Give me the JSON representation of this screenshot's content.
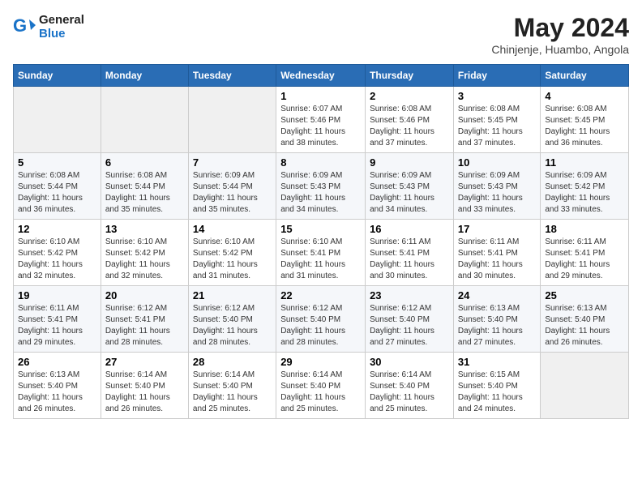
{
  "header": {
    "logo_line1": "General",
    "logo_line2": "Blue",
    "month": "May 2024",
    "location": "Chinjenje, Huambo, Angola"
  },
  "columns": [
    "Sunday",
    "Monday",
    "Tuesday",
    "Wednesday",
    "Thursday",
    "Friday",
    "Saturday"
  ],
  "weeks": [
    [
      {
        "day": "",
        "info": ""
      },
      {
        "day": "",
        "info": ""
      },
      {
        "day": "",
        "info": ""
      },
      {
        "day": "1",
        "info": "Sunrise: 6:07 AM\nSunset: 5:46 PM\nDaylight: 11 hours and 38 minutes."
      },
      {
        "day": "2",
        "info": "Sunrise: 6:08 AM\nSunset: 5:46 PM\nDaylight: 11 hours and 37 minutes."
      },
      {
        "day": "3",
        "info": "Sunrise: 6:08 AM\nSunset: 5:45 PM\nDaylight: 11 hours and 37 minutes."
      },
      {
        "day": "4",
        "info": "Sunrise: 6:08 AM\nSunset: 5:45 PM\nDaylight: 11 hours and 36 minutes."
      }
    ],
    [
      {
        "day": "5",
        "info": "Sunrise: 6:08 AM\nSunset: 5:44 PM\nDaylight: 11 hours and 36 minutes."
      },
      {
        "day": "6",
        "info": "Sunrise: 6:08 AM\nSunset: 5:44 PM\nDaylight: 11 hours and 35 minutes."
      },
      {
        "day": "7",
        "info": "Sunrise: 6:09 AM\nSunset: 5:44 PM\nDaylight: 11 hours and 35 minutes."
      },
      {
        "day": "8",
        "info": "Sunrise: 6:09 AM\nSunset: 5:43 PM\nDaylight: 11 hours and 34 minutes."
      },
      {
        "day": "9",
        "info": "Sunrise: 6:09 AM\nSunset: 5:43 PM\nDaylight: 11 hours and 34 minutes."
      },
      {
        "day": "10",
        "info": "Sunrise: 6:09 AM\nSunset: 5:43 PM\nDaylight: 11 hours and 33 minutes."
      },
      {
        "day": "11",
        "info": "Sunrise: 6:09 AM\nSunset: 5:42 PM\nDaylight: 11 hours and 33 minutes."
      }
    ],
    [
      {
        "day": "12",
        "info": "Sunrise: 6:10 AM\nSunset: 5:42 PM\nDaylight: 11 hours and 32 minutes."
      },
      {
        "day": "13",
        "info": "Sunrise: 6:10 AM\nSunset: 5:42 PM\nDaylight: 11 hours and 32 minutes."
      },
      {
        "day": "14",
        "info": "Sunrise: 6:10 AM\nSunset: 5:42 PM\nDaylight: 11 hours and 31 minutes."
      },
      {
        "day": "15",
        "info": "Sunrise: 6:10 AM\nSunset: 5:41 PM\nDaylight: 11 hours and 31 minutes."
      },
      {
        "day": "16",
        "info": "Sunrise: 6:11 AM\nSunset: 5:41 PM\nDaylight: 11 hours and 30 minutes."
      },
      {
        "day": "17",
        "info": "Sunrise: 6:11 AM\nSunset: 5:41 PM\nDaylight: 11 hours and 30 minutes."
      },
      {
        "day": "18",
        "info": "Sunrise: 6:11 AM\nSunset: 5:41 PM\nDaylight: 11 hours and 29 minutes."
      }
    ],
    [
      {
        "day": "19",
        "info": "Sunrise: 6:11 AM\nSunset: 5:41 PM\nDaylight: 11 hours and 29 minutes."
      },
      {
        "day": "20",
        "info": "Sunrise: 6:12 AM\nSunset: 5:41 PM\nDaylight: 11 hours and 28 minutes."
      },
      {
        "day": "21",
        "info": "Sunrise: 6:12 AM\nSunset: 5:40 PM\nDaylight: 11 hours and 28 minutes."
      },
      {
        "day": "22",
        "info": "Sunrise: 6:12 AM\nSunset: 5:40 PM\nDaylight: 11 hours and 28 minutes."
      },
      {
        "day": "23",
        "info": "Sunrise: 6:12 AM\nSunset: 5:40 PM\nDaylight: 11 hours and 27 minutes."
      },
      {
        "day": "24",
        "info": "Sunrise: 6:13 AM\nSunset: 5:40 PM\nDaylight: 11 hours and 27 minutes."
      },
      {
        "day": "25",
        "info": "Sunrise: 6:13 AM\nSunset: 5:40 PM\nDaylight: 11 hours and 26 minutes."
      }
    ],
    [
      {
        "day": "26",
        "info": "Sunrise: 6:13 AM\nSunset: 5:40 PM\nDaylight: 11 hours and 26 minutes."
      },
      {
        "day": "27",
        "info": "Sunrise: 6:14 AM\nSunset: 5:40 PM\nDaylight: 11 hours and 26 minutes."
      },
      {
        "day": "28",
        "info": "Sunrise: 6:14 AM\nSunset: 5:40 PM\nDaylight: 11 hours and 25 minutes."
      },
      {
        "day": "29",
        "info": "Sunrise: 6:14 AM\nSunset: 5:40 PM\nDaylight: 11 hours and 25 minutes."
      },
      {
        "day": "30",
        "info": "Sunrise: 6:14 AM\nSunset: 5:40 PM\nDaylight: 11 hours and 25 minutes."
      },
      {
        "day": "31",
        "info": "Sunrise: 6:15 AM\nSunset: 5:40 PM\nDaylight: 11 hours and 24 minutes."
      },
      {
        "day": "",
        "info": ""
      }
    ]
  ]
}
